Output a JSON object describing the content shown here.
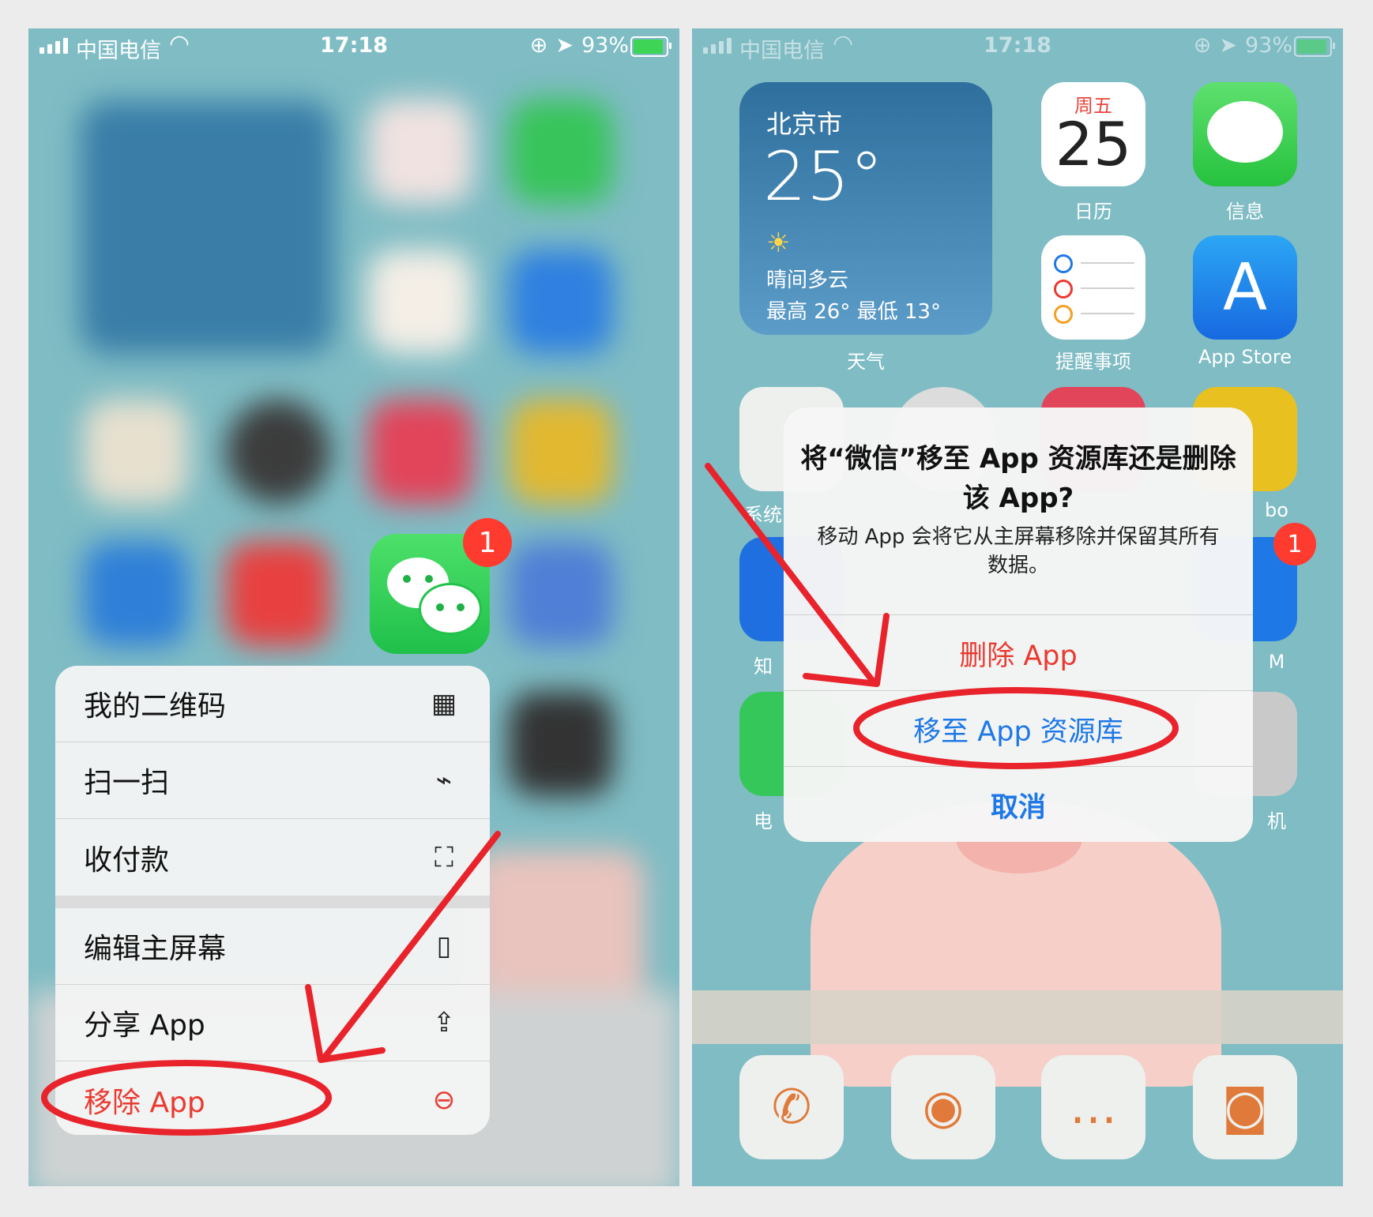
{
  "left": {
    "status": {
      "carrier": "中国电信",
      "time": "17:18",
      "battery": "93%"
    },
    "wechat_badge": "1",
    "menu": {
      "items": [
        {
          "label": "我的二维码",
          "icon": "qr-code-icon"
        },
        {
          "label": "扫一扫",
          "icon": "scan-icon"
        },
        {
          "label": "收付款",
          "icon": "payment-scan-icon"
        },
        {
          "label": "编辑主屏幕",
          "icon": "phone-outline-icon"
        },
        {
          "label": "分享 App",
          "icon": "share-icon"
        },
        {
          "label": "移除 App",
          "icon": "minus-circle-icon"
        }
      ]
    }
  },
  "right": {
    "status": {
      "carrier": "中国电信",
      "time": "17:18",
      "battery": "93%"
    },
    "weather": {
      "city": "北京市",
      "temp": "25°",
      "condition": "晴间多云",
      "hilo": "最高 26° 最低 13°",
      "label": "天气"
    },
    "calendar": {
      "weekday": "周五",
      "day": "25",
      "label": "日历"
    },
    "messages_label": "信息",
    "reminders_label": "提醒事项",
    "appstore_label": "App Store",
    "partial_labels": {
      "sys": "系统",
      "bo": "bo",
      "zhi": "知",
      "m": "M",
      "dian": "电",
      "ji": "机"
    },
    "badge": "1",
    "dialog": {
      "title": "将“微信”移至 App 资源库还是删除该 App?",
      "body": "移动 App 会将它从主屏幕移除并保留其所有数据。",
      "delete": "删除 App",
      "move": "移至 App 资源库",
      "cancel": "取消"
    },
    "colors": {
      "danger": "#ea3a30",
      "link": "#1e78e6",
      "annotation": "#e8232b"
    }
  }
}
